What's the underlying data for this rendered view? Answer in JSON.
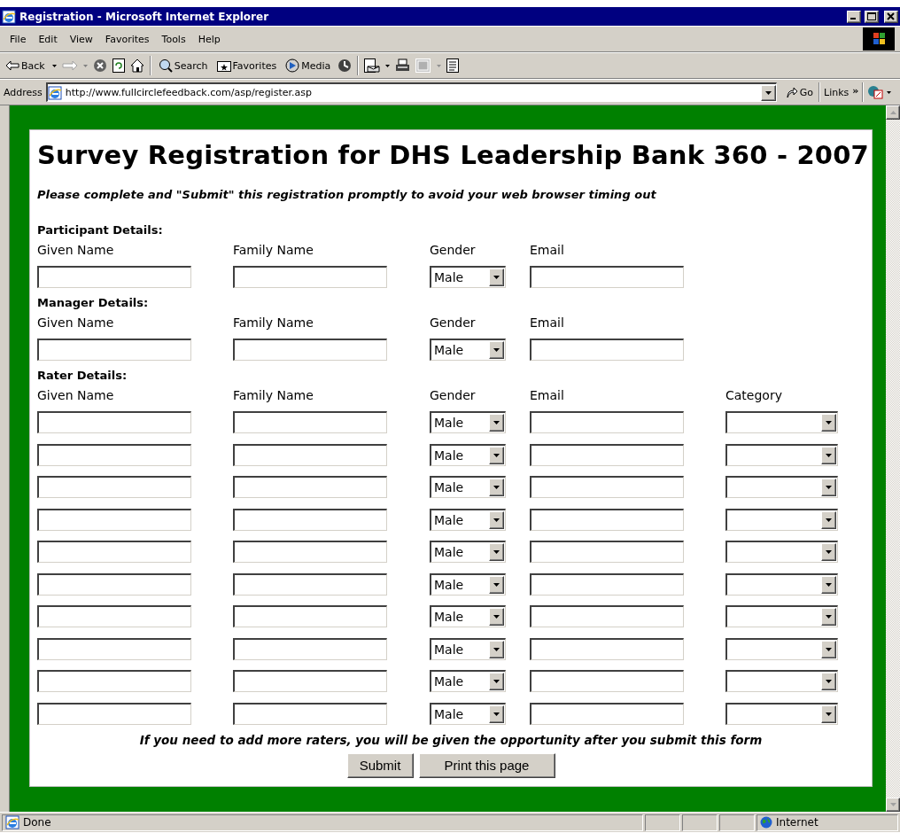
{
  "window": {
    "title": "Registration - Microsoft Internet Explorer"
  },
  "menu": [
    "File",
    "Edit",
    "View",
    "Favorites",
    "Tools",
    "Help"
  ],
  "toolbar": [
    "Back",
    "Search",
    "Favorites",
    "Media"
  ],
  "address": {
    "label": "Address",
    "url": "http://www.fullcirclefeedback.com/asp/register.asp",
    "go": "Go",
    "links": "Links",
    "more": "»"
  },
  "page": {
    "title": "Survey Registration for DHS Leadership Bank 360 - 2007",
    "notice": "Please complete and \"Submit\" this registration promptly to avoid your web browser timing out",
    "sections": [
      {
        "heading": "Participant Details:",
        "columns": [
          {
            "label": "Given Name",
            "kind": "text"
          },
          {
            "label": "Family Name",
            "kind": "text"
          },
          {
            "label": "Gender",
            "kind": "gender"
          },
          {
            "label": "Email",
            "kind": "text"
          }
        ],
        "rows": [
          {
            "gender": "Male"
          }
        ]
      },
      {
        "heading": "Manager Details:",
        "columns": [
          {
            "label": "Given Name",
            "kind": "text"
          },
          {
            "label": "Family Name",
            "kind": "text"
          },
          {
            "label": "Gender",
            "kind": "gender"
          },
          {
            "label": "Email",
            "kind": "text"
          }
        ],
        "rows": [
          {
            "gender": "Male"
          }
        ]
      },
      {
        "heading": "Rater Details:",
        "columns": [
          {
            "label": "Given Name",
            "kind": "text"
          },
          {
            "label": "Family Name",
            "kind": "text"
          },
          {
            "label": "Gender",
            "kind": "gender"
          },
          {
            "label": "Email",
            "kind": "text"
          },
          {
            "label": "Category",
            "kind": "category"
          }
        ],
        "rows": [
          {
            "gender": "Male"
          },
          {
            "gender": "Male"
          },
          {
            "gender": "Male"
          },
          {
            "gender": "Male"
          },
          {
            "gender": "Male"
          },
          {
            "gender": "Male"
          },
          {
            "gender": "Male"
          },
          {
            "gender": "Male"
          },
          {
            "gender": "Male"
          },
          {
            "gender": "Male"
          }
        ]
      }
    ],
    "footnote": "If you need to add more raters, you will be given the opportunity after you submit this form",
    "buttons": [
      "Submit",
      "Print this page"
    ]
  },
  "status_bar": {
    "text": "Done",
    "zone": "Internet"
  }
}
